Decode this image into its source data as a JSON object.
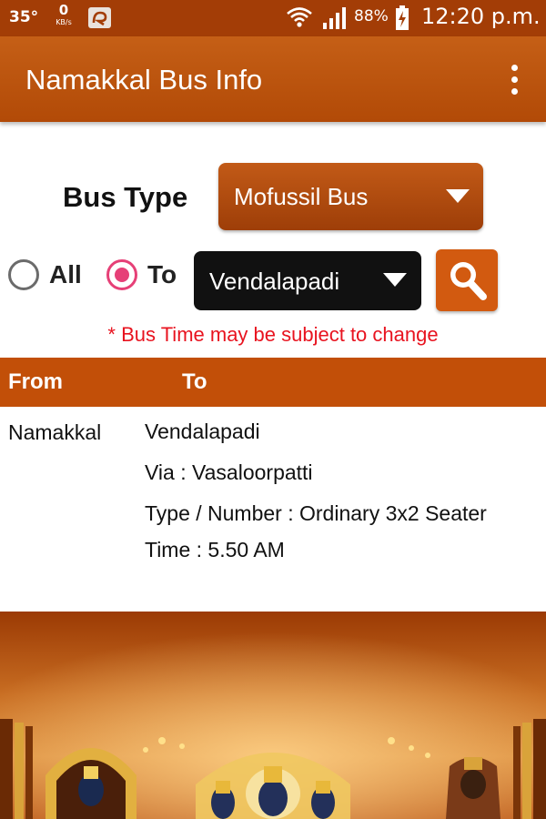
{
  "status_bar": {
    "temperature": "35°",
    "net_speed_value": "0",
    "net_speed_unit": "KB/s",
    "battery_percent": "88%",
    "time": "12:20 p.m.",
    "icons": [
      "app-notification-icon",
      "wifi-icon",
      "signal-icon",
      "battery-charging-icon"
    ]
  },
  "app_bar": {
    "title": "Namakkal Bus Info",
    "menu_icon": "more-vert-icon"
  },
  "filters": {
    "bus_type_label": "Bus Type",
    "bus_type_value": "Mofussil Bus",
    "radio_all_label": "All",
    "radio_to_label": "To",
    "selected_radio": "To",
    "destination_value": "Vendalapadi",
    "search_icon": "search-icon"
  },
  "disclaimer": "* Bus Time may be subject to change",
  "table": {
    "headers": {
      "from": "From",
      "to": "To"
    },
    "rows": [
      {
        "from": "Namakkal",
        "to": "Vendalapadi",
        "via": "Via : Vasaloorpatti",
        "type": "Type / Number :  Ordinary 3x2 Seater",
        "time": "Time : 5.50 AM"
      }
    ]
  },
  "colors": {
    "primary": "#c24f08",
    "status_bar": "#a33d06",
    "accent_radio": "#e64077",
    "warning_text": "#e8131f",
    "dropdown_dark": "#111111"
  }
}
